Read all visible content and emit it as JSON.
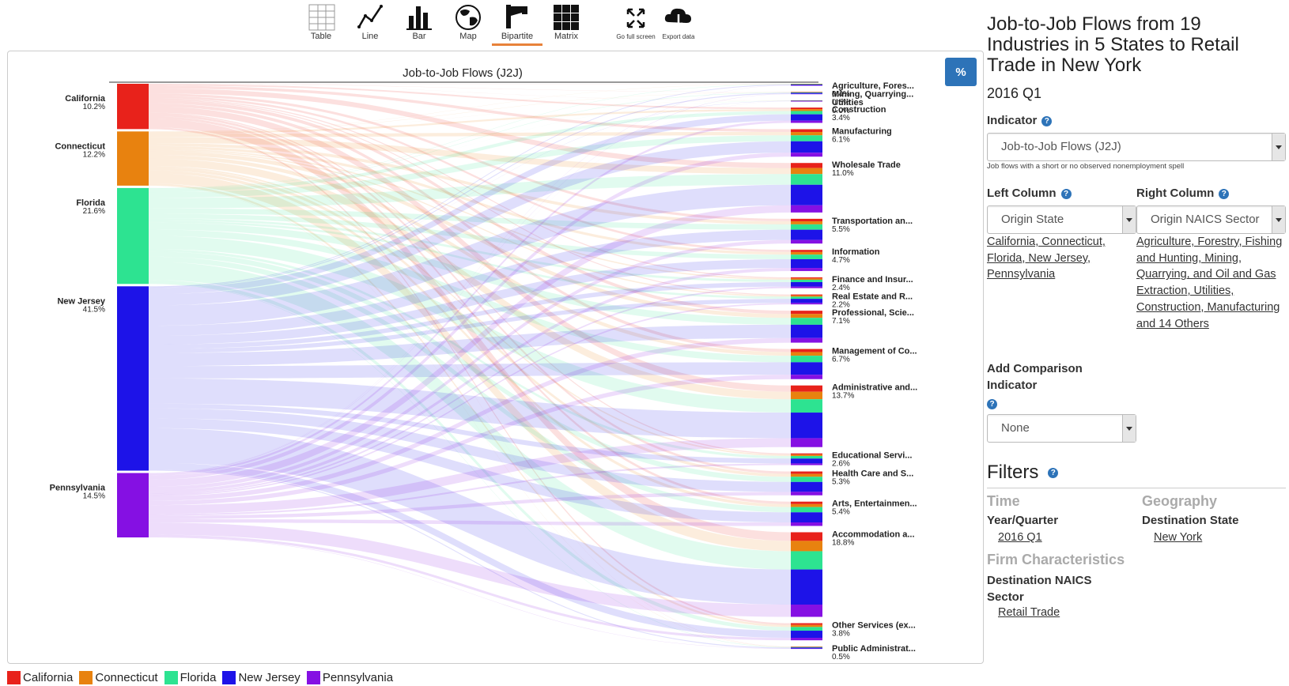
{
  "toolbar": {
    "items": [
      {
        "label": "Table"
      },
      {
        "label": "Line"
      },
      {
        "label": "Bar"
      },
      {
        "label": "Map"
      },
      {
        "label": "Bipartite",
        "active": true
      },
      {
        "label": "Matrix"
      },
      {
        "label": "Go full screen"
      },
      {
        "label": "Export data"
      }
    ]
  },
  "chart": {
    "title": "Job-to-Job Flows (J2J)",
    "percent_button": "%",
    "left_nodes": [
      {
        "name": "California",
        "pct": "10.2%",
        "color": "#e8221b"
      },
      {
        "name": "Connecticut",
        "pct": "12.2%",
        "color": "#e8820f"
      },
      {
        "name": "Florida",
        "pct": "21.6%",
        "color": "#2de391"
      },
      {
        "name": "New Jersey",
        "pct": "41.5%",
        "color": "#1d13e8"
      },
      {
        "name": "Pennsylvania",
        "pct": "14.5%",
        "color": "#8510e3"
      }
    ],
    "right_nodes": [
      {
        "name": "Agriculture, Fores...",
        "pct": "0.4%"
      },
      {
        "name": "Mining, Quarrying...",
        "pct": "0.5%"
      },
      {
        "name": "Utilities",
        "pct": "0.0%"
      },
      {
        "name": "Construction",
        "pct": "3.4%"
      },
      {
        "name": "Manufacturing",
        "pct": "6.1%"
      },
      {
        "name": "Wholesale Trade",
        "pct": "11.0%"
      },
      {
        "name": "Transportation an...",
        "pct": "5.5%"
      },
      {
        "name": "Information",
        "pct": "4.7%"
      },
      {
        "name": "Finance and Insur...",
        "pct": "2.4%"
      },
      {
        "name": "Real Estate and R...",
        "pct": "2.2%"
      },
      {
        "name": "Professional, Scie...",
        "pct": "7.1%"
      },
      {
        "name": "Management of Co...",
        "pct": "6.7%"
      },
      {
        "name": "Administrative and...",
        "pct": "13.7%"
      },
      {
        "name": "Educational Servi...",
        "pct": "2.6%"
      },
      {
        "name": "Health Care and S...",
        "pct": "5.3%"
      },
      {
        "name": "Arts, Entertainmen...",
        "pct": "5.4%"
      },
      {
        "name": "Accommodation a...",
        "pct": "18.8%"
      },
      {
        "name": "Other Services (ex...",
        "pct": "3.8%"
      },
      {
        "name": "Public Administrat...",
        "pct": "0.5%"
      }
    ]
  },
  "legend": [
    {
      "name": "California",
      "color": "#e8221b"
    },
    {
      "name": "Connecticut",
      "color": "#e8820f"
    },
    {
      "name": "Florida",
      "color": "#2de391"
    },
    {
      "name": "New Jersey",
      "color": "#1d13e8"
    },
    {
      "name": "Pennsylvania",
      "color": "#8510e3"
    }
  ],
  "sidebar": {
    "title": "Job-to-Job Flows from 19 Industries in 5 States to Retail Trade in New York",
    "period": "2016 Q1",
    "indicator_label": "Indicator",
    "indicator_value": "Job-to-Job Flows (J2J)",
    "indicator_desc": "Job flows with a short or no observed nonemployment spell",
    "left_column_label": "Left Column",
    "left_column_value": "Origin State",
    "left_column_links": "California, Connecticut, Florida, New Jersey, Pennsylvania",
    "right_column_label": "Right Column",
    "right_column_value": "Origin NAICS Sector",
    "right_column_links": "Agriculture, Forestry, Fishing and Hunting, Mining, Quarrying, and Oil and Gas Extraction, Utilities, Construction, Manufacturing and 14 Others",
    "comparison_label": "Add Comparison Indicator",
    "comparison_value": "None",
    "filters_title": "Filters",
    "time_header": "Time",
    "year_quarter_label": "Year/Quarter",
    "year_quarter_value": "2016 Q1",
    "geography_header": "Geography",
    "dest_state_label": "Destination State",
    "dest_state_value": "New York",
    "firm_header": "Firm Characteristics",
    "dest_naics_label": "Destination NAICS Sector",
    "dest_naics_value": "Retail Trade"
  },
  "colors": {
    "accent": "#2d73b8",
    "tab_underline": "#e8823a"
  }
}
